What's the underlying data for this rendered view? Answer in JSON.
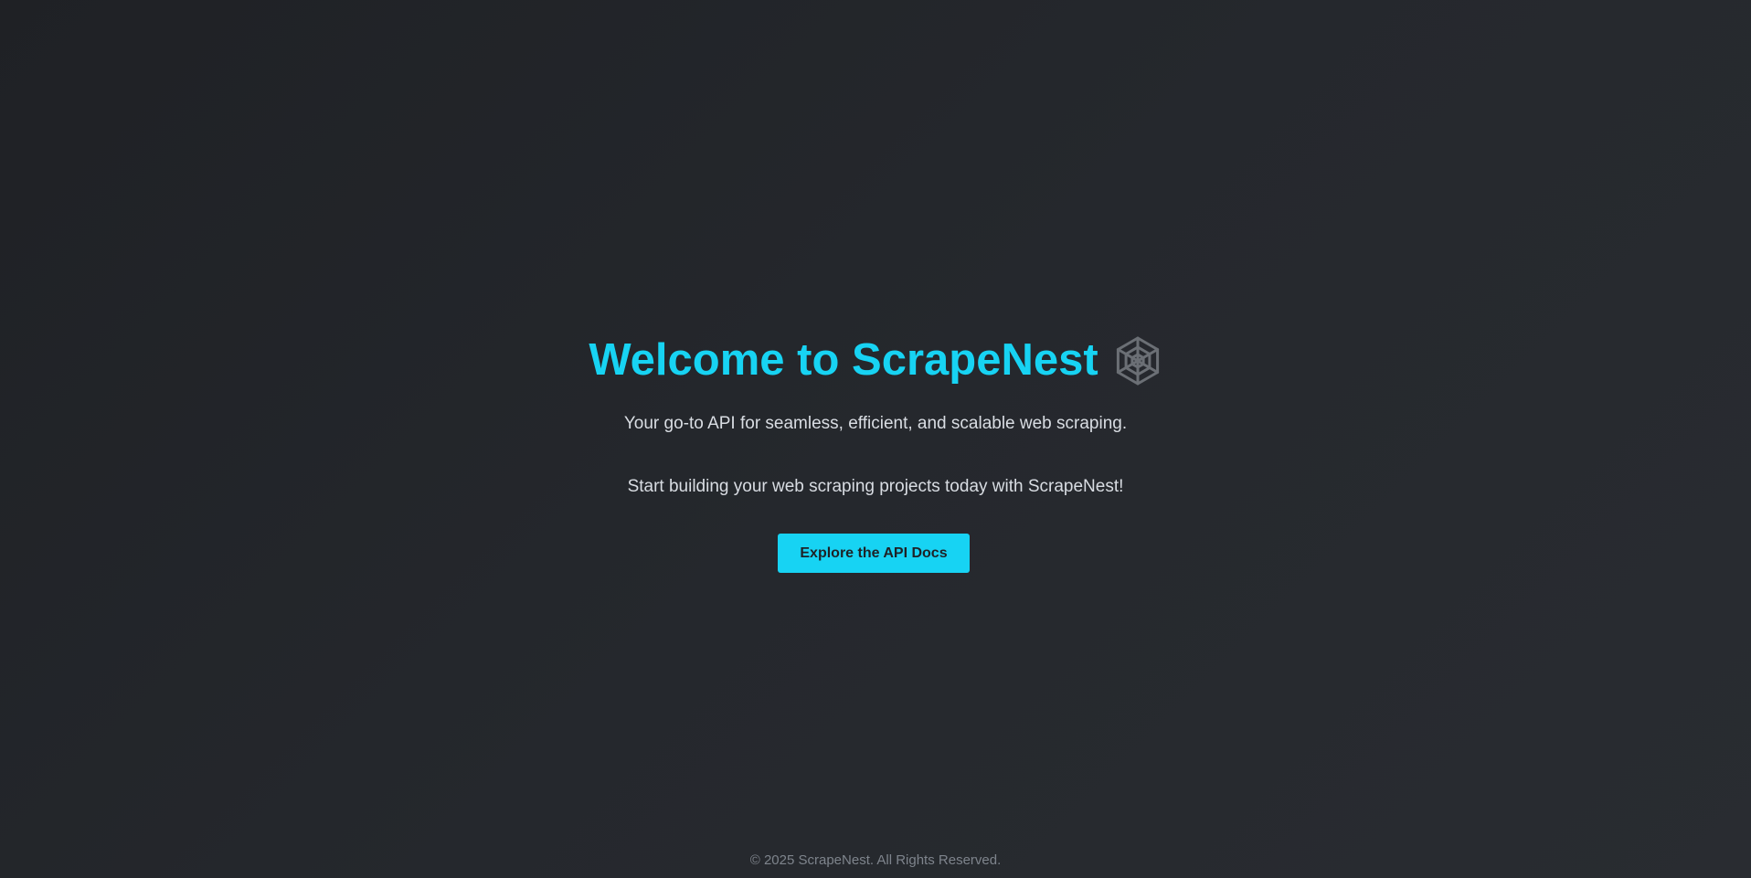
{
  "theme": {
    "accent": "#17d3f3",
    "icon_color": "#6b6f75"
  },
  "hero": {
    "title": "Welcome to ScrapeNest",
    "title_icon": "spider-web-icon",
    "tagline": "Your go-to API for seamless, efficient, and scalable web scraping.",
    "cta_text": "Start building your web scraping projects today with ScrapeNest!",
    "cta_button_label": "Explore the API Docs"
  },
  "footer": {
    "copyright": "© 2025 ScrapeNest. All Rights Reserved."
  }
}
